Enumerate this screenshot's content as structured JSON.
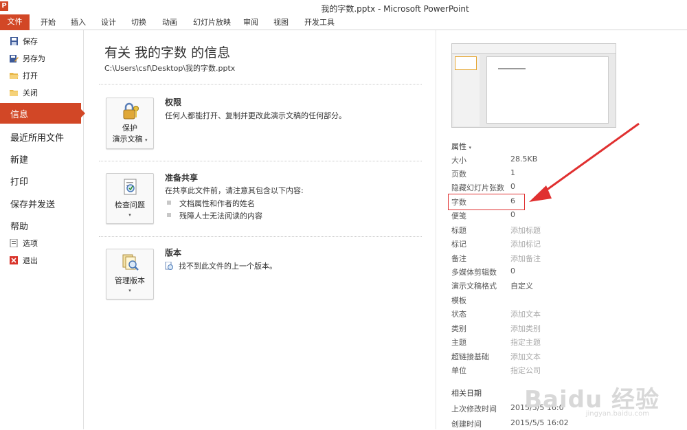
{
  "window": {
    "app_icon": "P",
    "title": "我的字数.pptx  -  Microsoft PowerPoint"
  },
  "ribbon": {
    "file_tab": "文件",
    "tabs": [
      "开始",
      "插入",
      "设计",
      "切换",
      "动画",
      "幻灯片放映",
      "审阅",
      "视图",
      "开发工具"
    ]
  },
  "nav": {
    "save": "保存",
    "save_as": "另存为",
    "open": "打开",
    "close": "关闭",
    "info": "信息",
    "recent": "最近所用文件",
    "new": "新建",
    "print": "打印",
    "save_send": "保存并发送",
    "help": "帮助",
    "options": "选项",
    "exit": "退出"
  },
  "info": {
    "title": "有关 我的字数 的信息",
    "path": "C:\\Users\\csf\\Desktop\\我的字数.pptx",
    "permissions": {
      "button_line1": "保护",
      "button_line2": "演示文稿",
      "heading": "权限",
      "text": "任何人都能打开、复制并更改此演示文稿的任何部分。"
    },
    "sharing": {
      "button_line1": "检查问题",
      "heading": "准备共享",
      "text": "在共享此文件前，请注意其包含以下内容:",
      "items": [
        "文档属性和作者的姓名",
        "残障人士无法阅读的内容"
      ]
    },
    "versions": {
      "button_line1": "管理版本",
      "heading": "版本",
      "text": "找不到此文件的上一个版本。"
    }
  },
  "properties": {
    "header": "属性",
    "rows": [
      {
        "key": "大小",
        "value": "28.5KB"
      },
      {
        "key": "页数",
        "value": "1"
      },
      {
        "key": "隐藏幻灯片张数",
        "value": "0"
      },
      {
        "key": "字数",
        "value": "6"
      },
      {
        "key": "便笺",
        "value": "0"
      },
      {
        "key": "标题",
        "value": "添加标题"
      },
      {
        "key": "标记",
        "value": "添加标记"
      },
      {
        "key": "备注",
        "value": "添加备注"
      },
      {
        "key": "多媒体剪辑数",
        "value": "0"
      },
      {
        "key": "演示文稿格式",
        "value": "自定义"
      },
      {
        "key": "模板",
        "value": ""
      },
      {
        "key": "状态",
        "value": "添加文本"
      },
      {
        "key": "类别",
        "value": "添加类别"
      },
      {
        "key": "主题",
        "value": "指定主题"
      },
      {
        "key": "超链接基础",
        "value": "添加文本"
      },
      {
        "key": "单位",
        "value": "指定公司"
      }
    ],
    "dates_header": "相关日期",
    "dates": [
      {
        "key": "上次修改时间",
        "value": "2015/5/5 16:0"
      },
      {
        "key": "创建时间",
        "value": "2015/5/5 16:02"
      }
    ]
  },
  "watermark": {
    "logo": "Baidu 经验",
    "url": "jingyan.baidu.com"
  },
  "colors": {
    "accent": "#d24726",
    "highlight": "#e03030"
  }
}
